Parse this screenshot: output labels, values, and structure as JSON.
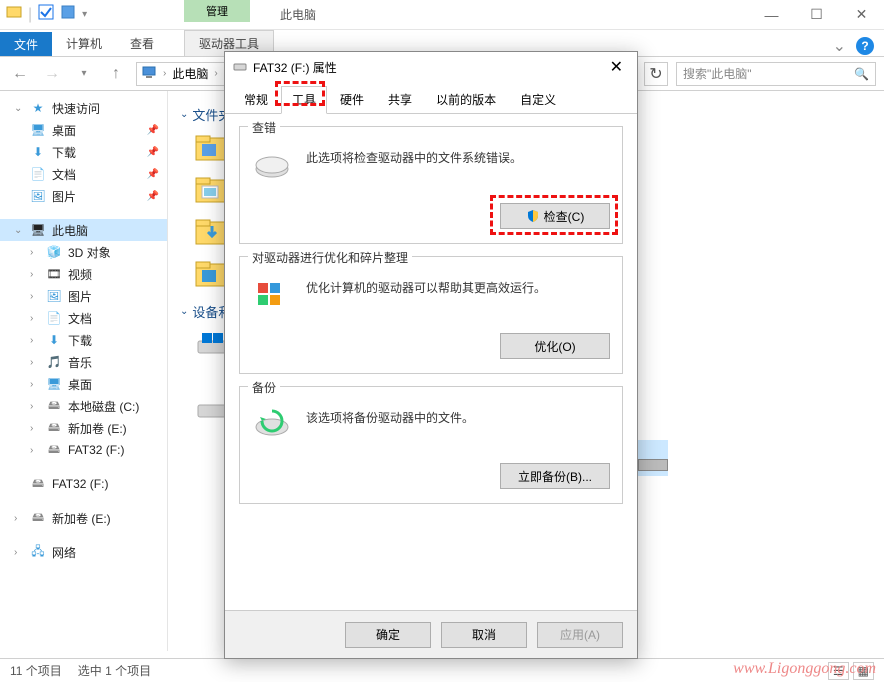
{
  "titlebar": {
    "app_title": "此电脑"
  },
  "ribbon": {
    "file": "文件",
    "computer": "计算机",
    "view": "查看",
    "group_manage": "管理",
    "drive_tools": "驱动器工具"
  },
  "nav": {
    "location": "此电脑",
    "search_placeholder": "搜索\"此电脑\""
  },
  "sidebar": {
    "quick_access": "快速访问",
    "desktop": "桌面",
    "downloads": "下载",
    "documents": "文档",
    "pictures": "图片",
    "this_pc": "此电脑",
    "objects3d": "3D 对象",
    "videos": "视频",
    "pictures2": "图片",
    "documents2": "文档",
    "downloads2": "下载",
    "music": "音乐",
    "desktop2": "桌面",
    "local_disk_c": "本地磁盘 (C:)",
    "volume_e": "新加卷 (E:)",
    "fat32_f": "FAT32 (F:)",
    "fat32_f2": "FAT32 (F:)",
    "volume_e2": "新加卷 (E:)",
    "network": "网络"
  },
  "content": {
    "folders_section": "文件夹",
    "devices_section": "设备和"
  },
  "statusbar": {
    "items": "11 个项目",
    "selected": "选中 1 个项目"
  },
  "dialog": {
    "title": "FAT32 (F:) 属性",
    "tabs": {
      "general": "常规",
      "tools": "工具",
      "hardware": "硬件",
      "sharing": "共享",
      "previous": "以前的版本",
      "customize": "自定义"
    },
    "error_check": {
      "legend": "查错",
      "desc": "此选项将检查驱动器中的文件系统错误。",
      "button": "检查(C)"
    },
    "optimize": {
      "legend": "对驱动器进行优化和碎片整理",
      "desc": "优化计算机的驱动器可以帮助其更高效运行。",
      "button": "优化(O)"
    },
    "backup": {
      "legend": "备份",
      "desc": "该选项将备份驱动器中的文件。",
      "button": "立即备份(B)..."
    },
    "footer": {
      "ok": "确定",
      "cancel": "取消",
      "apply": "应用(A)"
    }
  },
  "watermark": "www.Ligonggong.com"
}
